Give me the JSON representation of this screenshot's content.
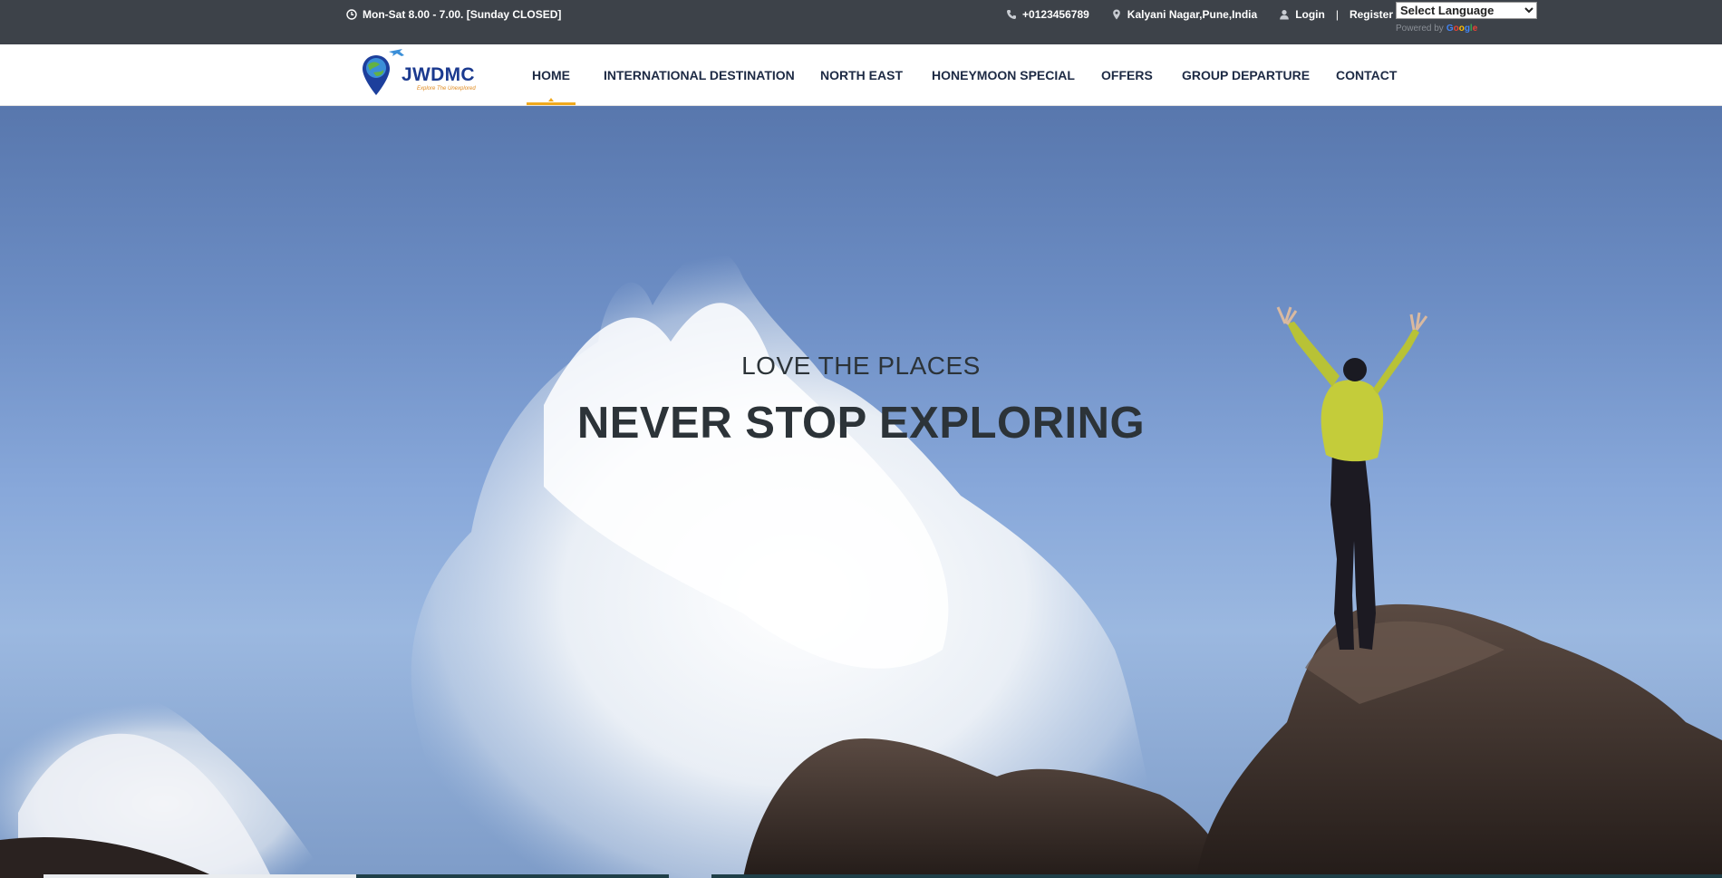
{
  "topbar": {
    "hours": "Mon-Sat 8.00 - 7.00. [Sunday CLOSED]",
    "phone": "+0123456789",
    "location": "Kalyani Nagar,Pune,India",
    "login": "Login",
    "separator": "|",
    "register": "Register",
    "language_select": "Select Language",
    "powered_by": "Powered by",
    "google": [
      "G",
      "o",
      "o",
      "g",
      "l",
      "e"
    ],
    "icons": {
      "hours": "clock-icon",
      "phone": "phone-icon",
      "location": "map-pin-icon",
      "login": "user-icon"
    }
  },
  "brand": {
    "name": "JWDMC",
    "tagline": "Explore The Unexplored",
    "logo_icon": "globe-pin-plane-logo"
  },
  "nav": {
    "items": [
      {
        "label": "HOME",
        "active": true
      },
      {
        "label": "INTERNATIONAL DESTINATION",
        "active": false
      },
      {
        "label": "NORTH EAST",
        "active": false
      },
      {
        "label": "HONEYMOON SPECIAL",
        "active": false
      },
      {
        "label": "OFFERS",
        "active": false
      },
      {
        "label": "GROUP DEPARTURE",
        "active": false
      },
      {
        "label": "CONTACT",
        "active": false
      }
    ]
  },
  "hero": {
    "subtitle": "LOVE THE PLACES",
    "title": "NEVER STOP EXPLORING"
  },
  "colors": {
    "topbar_bg": "#3d4249",
    "nav_bg": "#ffffff",
    "nav_text": "#1d2a44",
    "accent": "#f1a91d",
    "hero_text": "#2c3338",
    "brand_blue": "#1b3a8f"
  }
}
